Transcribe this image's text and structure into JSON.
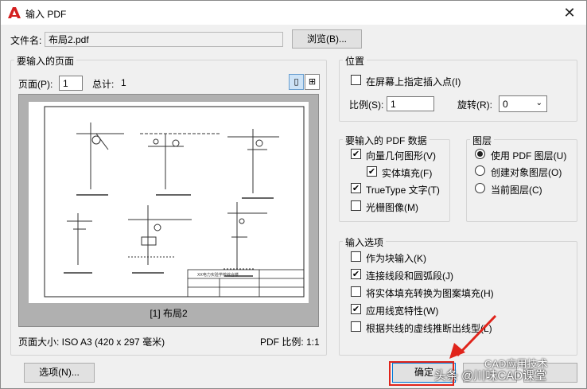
{
  "window": {
    "title": "输入 PDF",
    "close_glyph": "✕"
  },
  "file": {
    "label": "文件名:",
    "value": "布局2.pdf",
    "browse_label": "浏览(B)..."
  },
  "page_group": {
    "title": "要输入的页面",
    "page_label": "页面(P):",
    "page_value": "1",
    "total_label": "总计:",
    "total_value": "1",
    "preview_caption": "[1] 布局2",
    "page_size_label": "页面大小: ISO A3 (420 x 297 毫米)",
    "pdf_scale_label": "PDF 比例: 1:1"
  },
  "position": {
    "title": "位置",
    "specify_on_screen_label": "在屏幕上指定插入点(I)",
    "specify_on_screen_checked": false,
    "scale_label": "比例(S):",
    "scale_value": "1",
    "rotation_label": "旋转(R):",
    "rotation_value": "0"
  },
  "pdf_data": {
    "title": "要输入的 PDF 数据",
    "items": [
      {
        "label": "向量几何图形(V)",
        "checked": true
      },
      {
        "label": "实体填充(F)",
        "checked": true
      },
      {
        "label": "TrueType 文字(T)",
        "checked": true
      },
      {
        "label": "光栅图像(M)",
        "checked": false
      }
    ]
  },
  "layers": {
    "title": "图层",
    "options": [
      {
        "label": "使用 PDF 图层(U)",
        "selected": true
      },
      {
        "label": "创建对象图层(O)",
        "selected": false
      },
      {
        "label": "当前图层(C)",
        "selected": false
      }
    ]
  },
  "import_options": {
    "title": "输入选项",
    "items": [
      {
        "label": "作为块输入(K)",
        "checked": false
      },
      {
        "label": "连接线段和圆弧段(J)",
        "checked": true
      },
      {
        "label": "将实体填充转换为图案填充(H)",
        "checked": false
      },
      {
        "label": "应用线宽特性(W)",
        "checked": true
      },
      {
        "label": "根据共线的虚线推断出线型(L)",
        "checked": false
      }
    ]
  },
  "footer": {
    "options_label": "选项(N)...",
    "ok_label": "确定"
  },
  "overlay": {
    "watermark_text": "头条 @川味CAD课堂",
    "watermark_sub": "CAD应用技术"
  },
  "drawing": {
    "title_block_text": "XX电力实验学校综合楼"
  },
  "colors": {
    "annotation_red": "#e0241b",
    "icon_red": "#d42020"
  },
  "check_glyph": "✔",
  "icons": {
    "app": "autocad-a-icon",
    "view_single": "single-page-icon",
    "view_grid": "grid-view-icon"
  }
}
